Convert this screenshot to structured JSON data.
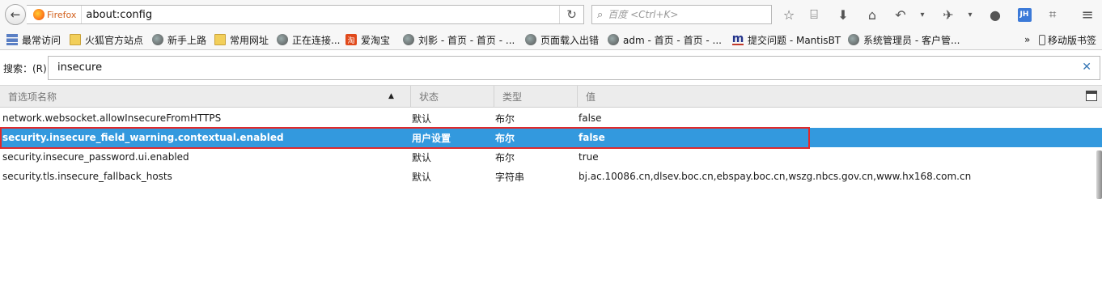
{
  "navbar": {
    "identity_label": "Firefox",
    "url": "about:config",
    "search_placeholder": "百度 <Ctrl+K>",
    "account_badge": "JH"
  },
  "bookmarks": [
    {
      "label": "最常访问",
      "icon": "bars"
    },
    {
      "label": "火狐官方站点",
      "icon": "folder"
    },
    {
      "label": "新手上路",
      "icon": "globe"
    },
    {
      "label": "常用网址",
      "icon": "folder"
    },
    {
      "label": "正在连接...",
      "icon": "globe"
    },
    {
      "label": "爱淘宝",
      "icon": "taobao"
    },
    {
      "label": "刘影 - 首页 - 首页 - ...",
      "icon": "globe"
    },
    {
      "label": "页面载入出错",
      "icon": "globe"
    },
    {
      "label": "adm - 首页 - 首页 - ...",
      "icon": "globe"
    },
    {
      "label": "提交问题 - MantisBT",
      "icon": "mantis"
    },
    {
      "label": "系统管理员 - 客户管...",
      "icon": "globe"
    }
  ],
  "bookmarks_overflow": "»",
  "mobile_bookmarks": "移动版书签",
  "taobao_glyph": "淘",
  "mantis_glyph": "m",
  "config": {
    "search_label": "搜索：(R)",
    "filter_value": "insecure",
    "clear_glyph": "✕"
  },
  "columns": {
    "name": "首选项名称",
    "status": "状态",
    "type": "类型",
    "value": "值"
  },
  "rows": [
    {
      "name": "network.websocket.allowInsecureFromHTTPS",
      "status": "默认",
      "type": "布尔",
      "value": "false"
    },
    {
      "name": "security.insecure_field_warning.contextual.enabled",
      "status": "用户设置",
      "type": "布尔",
      "value": "false",
      "selected": true
    },
    {
      "name": "security.insecure_password.ui.enabled",
      "status": "默认",
      "type": "布尔",
      "value": "true"
    },
    {
      "name": "security.tls.insecure_fallback_hosts",
      "status": "默认",
      "type": "字符串",
      "value": "bj.ac.10086.cn,dlsev.boc.cn,ebspay.boc.cn,wszg.nbcs.gov.cn,www.hx168.com.cn"
    }
  ],
  "colors": {
    "selection": "#3399de",
    "highlight_outline": "#e1292b",
    "accent_text": "#d25f1b"
  }
}
